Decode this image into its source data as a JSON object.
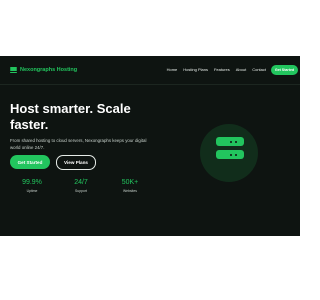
{
  "brand": {
    "name": "Nexongraphs Hosting",
    "icon": "stack-icon",
    "accent_color": "#22c55e"
  },
  "nav": {
    "links": [
      "Home",
      "Hosting Plans",
      "Features",
      "About",
      "Contact"
    ],
    "cta": "Get Started"
  },
  "hero": {
    "title": "Host smarter. Scale faster.",
    "subtitle": "From shared hosting to cloud servers, Nexongraphs keeps your digital world online 24/7.",
    "primary_button": "Get Started",
    "secondary_button": "View Plans"
  },
  "stats": [
    {
      "value": "99.9%",
      "label": "Uptime"
    },
    {
      "value": "24/7",
      "label": "Support"
    },
    {
      "value": "50K+",
      "label": "Websites"
    }
  ],
  "illustration": {
    "icon": "server-stack-icon"
  },
  "colors": {
    "background": "#0e1411",
    "accent": "#22c55e",
    "text": "#ffffff"
  }
}
